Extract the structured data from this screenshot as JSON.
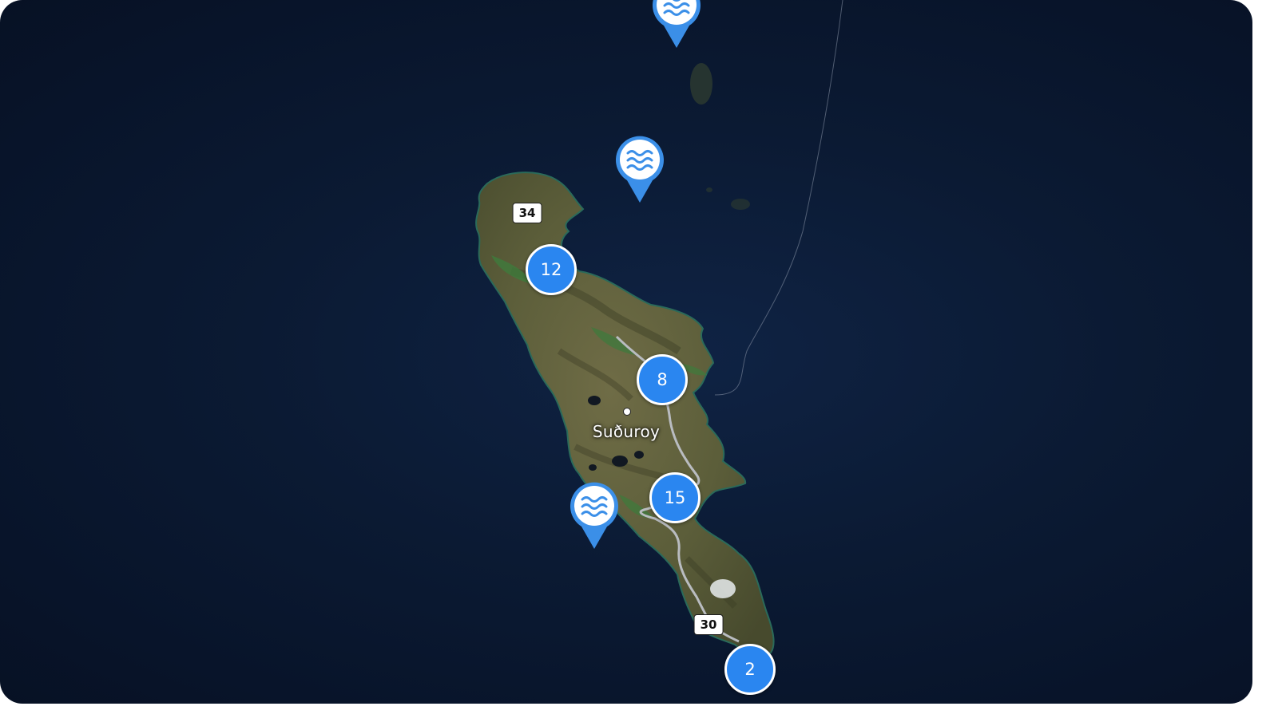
{
  "map": {
    "place_label": "Suðuroy",
    "road_shields": [
      {
        "id": "road-34",
        "label": "34"
      },
      {
        "id": "road-30",
        "label": "30"
      }
    ],
    "clusters": [
      {
        "id": "cluster-12",
        "count": "12"
      },
      {
        "id": "cluster-8",
        "count": "8"
      },
      {
        "id": "cluster-15",
        "count": "15"
      },
      {
        "id": "cluster-2",
        "count": "2"
      }
    ],
    "water_pins": [
      {
        "id": "water-pin-north",
        "icon": "water-waves-icon"
      },
      {
        "id": "water-pin-middle",
        "icon": "water-waves-icon"
      },
      {
        "id": "water-pin-west",
        "icon": "water-waves-icon"
      }
    ],
    "colors": {
      "ocean": "#0b1a33",
      "cluster": "#2a86f0",
      "pin": "#3b8fe8",
      "land": "#6b6b45",
      "land_green": "#3f7a3c"
    }
  }
}
